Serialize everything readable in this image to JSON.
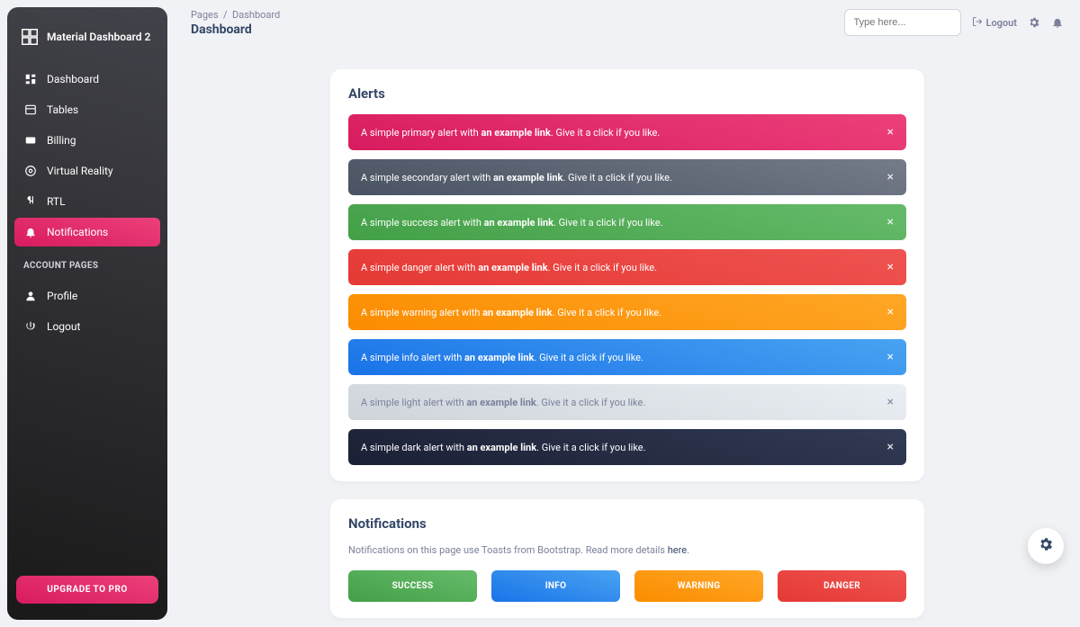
{
  "brand": {
    "name": "Material Dashboard 2"
  },
  "sidebar": {
    "items": [
      {
        "label": "Dashboard"
      },
      {
        "label": "Tables"
      },
      {
        "label": "Billing"
      },
      {
        "label": "Virtual Reality"
      },
      {
        "label": "RTL"
      },
      {
        "label": "Notifications"
      }
    ],
    "section_label": "ACCOUNT PAGES",
    "account_items": [
      {
        "label": "Profile"
      },
      {
        "label": "Logout"
      }
    ],
    "upgrade_label": "UPGRADE TO PRO"
  },
  "header": {
    "breadcrumb_root": "Pages",
    "breadcrumb_sep": "/",
    "breadcrumb_current": "Dashboard",
    "page_title": "Dashboard",
    "search_placeholder": "Type here...",
    "logout_label": "Logout"
  },
  "alerts_card": {
    "title": "Alerts",
    "link_text": "an example link",
    "after_link": ". Give it a click if you like.",
    "items": [
      {
        "type": "primary",
        "prefix": "A simple primary alert with "
      },
      {
        "type": "secondary",
        "prefix": "A simple secondary alert with "
      },
      {
        "type": "success",
        "prefix": "A simple success alert with "
      },
      {
        "type": "danger",
        "prefix": "A simple danger alert with "
      },
      {
        "type": "warning",
        "prefix": "A simple warning alert with "
      },
      {
        "type": "info",
        "prefix": "A simple info alert with "
      },
      {
        "type": "light",
        "prefix": "A simple light alert with "
      },
      {
        "type": "dark",
        "prefix": "A simple dark alert with "
      }
    ]
  },
  "notifications_card": {
    "title": "Notifications",
    "subtitle_prefix": "Notifications on this page use Toasts from Bootstrap. Read more details ",
    "subtitle_link": "here",
    "subtitle_suffix": ".",
    "buttons": [
      {
        "label": "SUCCESS",
        "variant": "success"
      },
      {
        "label": "INFO",
        "variant": "info"
      },
      {
        "label": "WARNING",
        "variant": "warning"
      },
      {
        "label": "DANGER",
        "variant": "danger"
      }
    ]
  }
}
